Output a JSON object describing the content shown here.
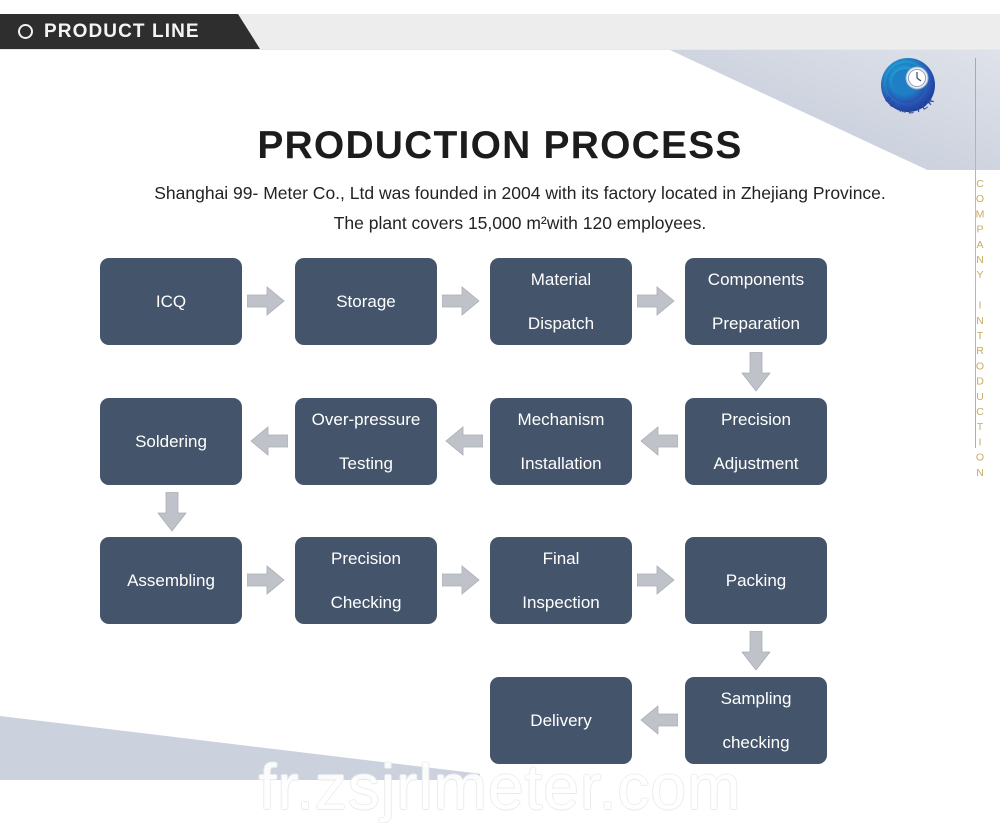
{
  "header": {
    "tab_label": "PRODUCT LINE",
    "bullet_icon": "circle-outline-icon",
    "bar_color": "#2e2e2e",
    "strip_color": "#ededed"
  },
  "brand": {
    "logo_icon": "99-meter-swirl-logo",
    "logo_text": "99 METER",
    "vertical_label": "COMPANY INTRODUCTION",
    "gold_color": "#c9ab5c"
  },
  "page": {
    "title": "PRODUCTION PROCESS",
    "subtitle": "Shanghai 99- Meter Co., Ltd was founded in 2004 with its factory located in Zhejiang Province. The plant covers 15,000 m²with 120 employees.",
    "watermark": "fr.zsjrlmeter.com",
    "node_color": "#44546a",
    "arrow_color": "#bfc3c9"
  },
  "chart_data": {
    "type": "diagram",
    "title": "PRODUCTION PROCESS",
    "rows": [
      {
        "direction": "left-to-right",
        "nodes": [
          "ICQ",
          "Storage",
          "Material Dispatch",
          "Components Preparation"
        ]
      },
      {
        "direction": "right-to-left",
        "nodes": [
          "Soldering",
          "Over-pressure Testing",
          "Mechanism Installation",
          "Precision Adjustment"
        ]
      },
      {
        "direction": "left-to-right",
        "nodes": [
          "Assembling",
          "Precision Checking",
          "Final Inspection",
          "Packing"
        ]
      },
      {
        "direction": "right-to-left",
        "nodes": [
          "Delivery",
          "Sampling checking"
        ]
      }
    ],
    "sequence": [
      "ICQ",
      "Storage",
      "Material Dispatch",
      "Components Preparation",
      "Precision Adjustment",
      "Mechanism Installation",
      "Over-pressure Testing",
      "Soldering",
      "Assembling",
      "Precision Checking",
      "Final Inspection",
      "Packing",
      "Sampling checking",
      "Delivery"
    ]
  },
  "nodes": {
    "n1": "ICQ",
    "n2": "Storage",
    "n3a": "Material",
    "n3b": "Dispatch",
    "n4a": "Components",
    "n4b": "Preparation",
    "n5": "Soldering",
    "n6a": "Over-pressure",
    "n6b": "Testing",
    "n7a": "Mechanism",
    "n7b": "Installation",
    "n8a": "Precision",
    "n8b": "Adjustment",
    "n9": "Assembling",
    "n10a": "Precision",
    "n10b": "Checking",
    "n11a": "Final",
    "n11b": "Inspection",
    "n12": "Packing",
    "n13": "Delivery",
    "n14a": "Sampling",
    "n14b": "checking"
  }
}
